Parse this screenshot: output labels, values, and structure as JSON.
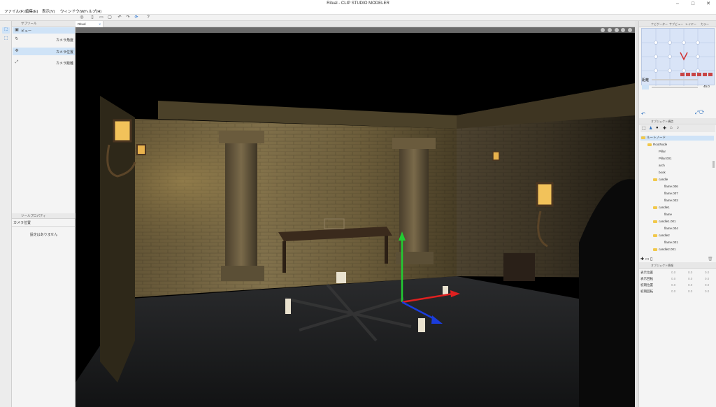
{
  "window": {
    "title": "Ritual - CLIP STUDIO MODELER"
  },
  "menu": [
    "ファイル(F)",
    "編集(E)",
    "表示(V)",
    "ウィンドウ(W)",
    "ヘルプ(H)"
  ],
  "left_panel": {
    "tool_tab": "サブツール",
    "tool_header": "ビュー",
    "subtools": [
      "カメラ角度",
      "カメラ位置",
      "カメラ距離"
    ],
    "property_tab": "ツールプロパティ",
    "property_title": "カメラ位置",
    "property_empty": "設定はありません"
  },
  "document": {
    "tab_label": "Ritual"
  },
  "right_panel": {
    "nav_tabs": [
      "ナビゲーター",
      "サブビュー",
      "レイヤー",
      "カラー"
    ],
    "distance_label": "距離",
    "distance_value": "45.0",
    "objects_tab": "オブジェクト構造",
    "root_label": "ルートノード",
    "tree": [
      {
        "label": "RootNode",
        "folder": true,
        "depth": 1
      },
      {
        "label": "Pillar",
        "folder": false,
        "depth": 2
      },
      {
        "label": "Pillar.001",
        "folder": false,
        "depth": 2
      },
      {
        "label": "arch",
        "folder": false,
        "depth": 2
      },
      {
        "label": "book",
        "folder": false,
        "depth": 2
      },
      {
        "label": "candle",
        "folder": true,
        "depth": 2
      },
      {
        "label": "flame.006",
        "folder": false,
        "depth": 3
      },
      {
        "label": "flame.007",
        "folder": false,
        "depth": 3
      },
      {
        "label": "flame.003",
        "folder": false,
        "depth": 3
      },
      {
        "label": "candle1",
        "folder": true,
        "depth": 2
      },
      {
        "label": "flame",
        "folder": false,
        "depth": 3
      },
      {
        "label": "candle1.001",
        "folder": true,
        "depth": 2
      },
      {
        "label": "flame.004",
        "folder": false,
        "depth": 3
      },
      {
        "label": "candle2",
        "folder": true,
        "depth": 2
      },
      {
        "label": "flame.001",
        "folder": false,
        "depth": 3
      },
      {
        "label": "candle2.001",
        "folder": true,
        "depth": 2
      }
    ],
    "transform_tab": "オブジェクト情報",
    "transform_rows": [
      {
        "label": "表示位置",
        "values": [
          "0.0",
          "0.0",
          "0.0"
        ]
      },
      {
        "label": "表示回転",
        "values": [
          "0.0",
          "0.0",
          "0.0"
        ]
      },
      {
        "label": "初期位置",
        "values": [
          "0.0",
          "0.0",
          "0.0"
        ]
      },
      {
        "label": "初期回転",
        "values": [
          "0.0",
          "0.0",
          "0.0"
        ]
      }
    ]
  },
  "colors": {
    "selection": "#cfe3f7",
    "accent": "#2a6fc0",
    "viewport_bg": "#000000"
  }
}
